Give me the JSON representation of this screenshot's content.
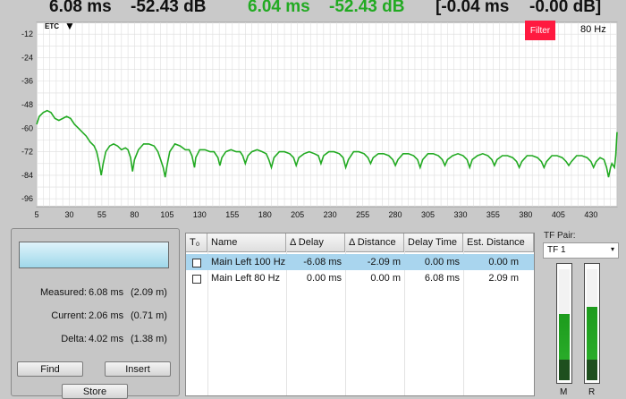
{
  "readout": {
    "measured_delay": "6.08 ms",
    "measured_level": "-52.43 dB",
    "current_delay": "6.04 ms",
    "current_level": "-52.43 dB",
    "delta_delay": "[-0.04 ms",
    "delta_level": "-0.00 dB]"
  },
  "chart_data": {
    "type": "line",
    "title": "ETC",
    "xlabel": "",
    "ylabel": "",
    "x_ticks": [
      5,
      30,
      55,
      80,
      105,
      130,
      155,
      180,
      205,
      230,
      255,
      280,
      305,
      330,
      355,
      380,
      405,
      430
    ],
    "y_ticks": [
      -12,
      -24,
      -36,
      -48,
      -60,
      -72,
      -84,
      -96
    ],
    "xlim": [
      5,
      450
    ],
    "ylim": [
      -100,
      -6
    ],
    "grid": true,
    "series": [
      {
        "color": "#22aa22",
        "points": [
          [
            5,
            -58
          ],
          [
            7,
            -54
          ],
          [
            10,
            -52
          ],
          [
            13,
            -51
          ],
          [
            16,
            -52
          ],
          [
            19,
            -55
          ],
          [
            22,
            -56
          ],
          [
            25,
            -55
          ],
          [
            28,
            -54
          ],
          [
            31,
            -55
          ],
          [
            34,
            -58
          ],
          [
            37,
            -60
          ],
          [
            40,
            -62
          ],
          [
            43,
            -64
          ],
          [
            46,
            -67
          ],
          [
            49,
            -69
          ],
          [
            51,
            -72
          ],
          [
            53,
            -78
          ],
          [
            54.5,
            -84
          ],
          [
            56,
            -78
          ],
          [
            58,
            -72
          ],
          [
            61,
            -69
          ],
          [
            64,
            -68
          ],
          [
            67,
            -69
          ],
          [
            70,
            -71
          ],
          [
            73,
            -70
          ],
          [
            75,
            -71
          ],
          [
            77,
            -75
          ],
          [
            78.5,
            -82
          ],
          [
            80,
            -76
          ],
          [
            83,
            -71
          ],
          [
            87,
            -68
          ],
          [
            91,
            -68
          ],
          [
            95,
            -69
          ],
          [
            98,
            -72
          ],
          [
            100,
            -76
          ],
          [
            102,
            -80
          ],
          [
            103.5,
            -85
          ],
          [
            105,
            -79
          ],
          [
            107,
            -72
          ],
          [
            111,
            -68
          ],
          [
            115,
            -69
          ],
          [
            119,
            -71
          ],
          [
            122,
            -71
          ],
          [
            124,
            -74
          ],
          [
            126,
            -80
          ],
          [
            127,
            -75
          ],
          [
            130,
            -71
          ],
          [
            134,
            -71
          ],
          [
            138,
            -72
          ],
          [
            141,
            -72
          ],
          [
            144,
            -75
          ],
          [
            145.5,
            -79
          ],
          [
            147,
            -75
          ],
          [
            150,
            -72
          ],
          [
            154,
            -71
          ],
          [
            158,
            -72
          ],
          [
            161,
            -72
          ],
          [
            163,
            -74
          ],
          [
            165,
            -78
          ],
          [
            167,
            -74
          ],
          [
            170,
            -72
          ],
          [
            174,
            -71
          ],
          [
            178,
            -72
          ],
          [
            181,
            -73
          ],
          [
            183,
            -76
          ],
          [
            185,
            -80
          ],
          [
            187,
            -75
          ],
          [
            191,
            -72
          ],
          [
            195,
            -72
          ],
          [
            199,
            -73
          ],
          [
            202,
            -75
          ],
          [
            204,
            -79
          ],
          [
            206,
            -75
          ],
          [
            210,
            -73
          ],
          [
            214,
            -72
          ],
          [
            218,
            -73
          ],
          [
            221,
            -74
          ],
          [
            223,
            -78
          ],
          [
            225,
            -74
          ],
          [
            229,
            -72
          ],
          [
            233,
            -72
          ],
          [
            237,
            -73
          ],
          [
            240,
            -75
          ],
          [
            242,
            -80
          ],
          [
            244,
            -76
          ],
          [
            248,
            -72
          ],
          [
            252,
            -72
          ],
          [
            256,
            -73
          ],
          [
            259,
            -75
          ],
          [
            261,
            -78
          ],
          [
            263,
            -75
          ],
          [
            267,
            -73
          ],
          [
            271,
            -73
          ],
          [
            275,
            -74
          ],
          [
            278,
            -76
          ],
          [
            280,
            -79
          ],
          [
            282,
            -76
          ],
          [
            286,
            -73
          ],
          [
            290,
            -73
          ],
          [
            294,
            -74
          ],
          [
            297,
            -76
          ],
          [
            299,
            -80
          ],
          [
            301,
            -76
          ],
          [
            305,
            -73
          ],
          [
            309,
            -73
          ],
          [
            313,
            -74
          ],
          [
            316,
            -76
          ],
          [
            318,
            -79
          ],
          [
            320,
            -76
          ],
          [
            324,
            -74
          ],
          [
            328,
            -73
          ],
          [
            332,
            -74
          ],
          [
            335,
            -76
          ],
          [
            337,
            -80
          ],
          [
            339,
            -76
          ],
          [
            343,
            -74
          ],
          [
            347,
            -73
          ],
          [
            351,
            -74
          ],
          [
            354,
            -76
          ],
          [
            356,
            -79
          ],
          [
            358,
            -76
          ],
          [
            362,
            -74
          ],
          [
            366,
            -74
          ],
          [
            370,
            -75
          ],
          [
            373,
            -77
          ],
          [
            375,
            -80
          ],
          [
            377,
            -77
          ],
          [
            381,
            -74
          ],
          [
            385,
            -74
          ],
          [
            389,
            -75
          ],
          [
            392,
            -77
          ],
          [
            394,
            -80
          ],
          [
            396,
            -77
          ],
          [
            400,
            -74
          ],
          [
            404,
            -74
          ],
          [
            408,
            -75
          ],
          [
            411,
            -77
          ],
          [
            413,
            -79
          ],
          [
            415,
            -77
          ],
          [
            419,
            -74
          ],
          [
            423,
            -74
          ],
          [
            427,
            -75
          ],
          [
            430,
            -77
          ],
          [
            432,
            -80
          ],
          [
            434,
            -77
          ],
          [
            437,
            -75
          ],
          [
            440,
            -76
          ],
          [
            442,
            -80
          ],
          [
            443.5,
            -85
          ],
          [
            445,
            -80
          ],
          [
            446,
            -78
          ],
          [
            448,
            -80
          ],
          [
            449,
            -74
          ],
          [
            450,
            -62
          ]
        ]
      }
    ]
  },
  "chart_controls": {
    "etc_label": "ETC",
    "dropdown_arrow": "▼",
    "filter_label": "Filter",
    "filter_color": "#ff1a40",
    "frequency": "80 Hz"
  },
  "measure_panel": {
    "measured_label": "Measured:",
    "measured_ms": "6.08 ms",
    "measured_m": "(2.09 m)",
    "current_label": "Current:",
    "current_ms": "2.06 ms",
    "current_m": "(0.71 m)",
    "delta_label": "Delta:",
    "delta_ms": "4.02 ms",
    "delta_m": "(1.38 m)",
    "find_label": "Find",
    "insert_label": "Insert",
    "store_label": "Store"
  },
  "delay_table": {
    "headers": [
      "T₀",
      "Name",
      "Δ Delay",
      "Δ Distance",
      "Delay Time",
      "Est. Distance"
    ],
    "rows": [
      {
        "name": "Main Left 100 Hz",
        "d_delay": "-6.08 ms",
        "d_distance": "-2.09 m",
        "delay_time": "0.00 ms",
        "est_distance": "0.00 m",
        "selected": true
      },
      {
        "name": "Main Left 80 Hz",
        "d_delay": "0.00 ms",
        "d_distance": "0.00 m",
        "delay_time": "6.08 ms",
        "est_distance": "2.09 m",
        "selected": false
      }
    ]
  },
  "tf_pair": {
    "label": "TF Pair:",
    "value": "TF 1",
    "arrow": "▾"
  },
  "level_meters": [
    {
      "label": "M",
      "level": 0.6
    },
    {
      "label": "R",
      "level": 0.67
    }
  ]
}
